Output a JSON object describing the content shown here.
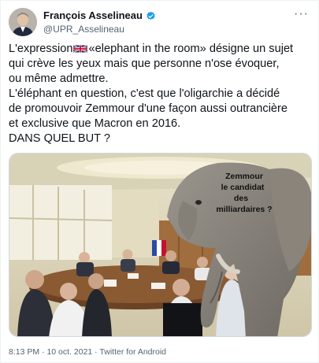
{
  "author": {
    "name": "François Asselineau",
    "handle": "@UPR_Asselineau",
    "verified": true
  },
  "tweet": {
    "para1_a": "L'expression",
    "para1_b": "«elephant in the room» désigne un sujet",
    "para1_line2": "qui crève les yeux mais que personne n'ose évoquer,",
    "para1_line3": "ou même admettre.",
    "para2_line1": "L'éléphant en question, c'est que l'oligarchie a décidé",
    "para2_line2": "de promouvoir Zemmour d'une façon aussi outrancière",
    "para2_line3": "et exclusive que Macron en 2016.",
    "para3": "DANS QUEL BUT ?",
    "flag_icon": "uk-flag-icon"
  },
  "image": {
    "caption_line1": "Zemmour",
    "caption_line2": "le candidat",
    "caption_line3": "des",
    "caption_line4": "milliardaires ?"
  },
  "meta": {
    "time": "8:13 PM",
    "separator": "·",
    "date": "10 oct. 2021",
    "client": "Twitter for Android"
  },
  "colors": {
    "verified_badge": "#1d9bf0",
    "text_primary": "#0f1419",
    "text_secondary": "#536471"
  }
}
